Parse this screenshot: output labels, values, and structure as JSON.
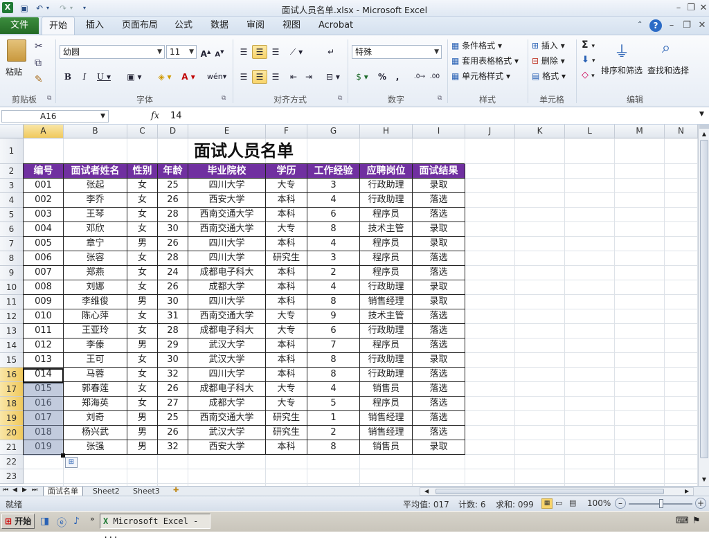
{
  "window": {
    "title": "面试人员名单.xlsx - Microsoft Excel"
  },
  "tabs": {
    "file": "文件",
    "home": "开始",
    "insert": "插入",
    "layout": "页面布局",
    "formulas": "公式",
    "data": "数据",
    "review": "审阅",
    "view": "视图",
    "acrobat": "Acrobat"
  },
  "ribbon": {
    "clipboard": {
      "label": "剪贴板",
      "paste": "粘贴"
    },
    "font": {
      "label": "字体",
      "name": "幼圆",
      "size": "11"
    },
    "align": {
      "label": "对齐方式"
    },
    "number": {
      "label": "数字",
      "format": "特殊",
      "percent": "%",
      "comma": ","
    },
    "styles": {
      "label": "样式",
      "cond": "条件格式",
      "table": "套用表格格式",
      "cellstyle": "单元格样式"
    },
    "cells": {
      "label": "单元格",
      "insert": "插入",
      "delete": "删除",
      "format": "格式"
    },
    "edit": {
      "label": "编辑",
      "sum": "Σ",
      "sort": "排序和筛选",
      "find": "查找和选择"
    }
  },
  "formula_bar": {
    "name_box": "A16",
    "fx": "fx",
    "value": "14"
  },
  "columns": [
    "A",
    "B",
    "C",
    "D",
    "E",
    "F",
    "G",
    "H",
    "I",
    "J",
    "K",
    "L",
    "M",
    "N"
  ],
  "rows": [
    "1",
    "2",
    "3",
    "4",
    "5",
    "6",
    "7",
    "8",
    "9",
    "10",
    "11",
    "12",
    "13",
    "14",
    "15",
    "16",
    "17",
    "18",
    "19",
    "20",
    "21",
    "22",
    "23"
  ],
  "sheet_title": "面试人员名单",
  "table": {
    "headers": [
      "编号",
      "面试者姓名",
      "性别",
      "年龄",
      "毕业院校",
      "学历",
      "工作经验",
      "应聘岗位",
      "面试结果"
    ],
    "rows": [
      [
        "001",
        "张起",
        "女",
        "25",
        "四川大学",
        "大专",
        "3",
        "行政助理",
        "录取"
      ],
      [
        "002",
        "李乔",
        "女",
        "26",
        "西安大学",
        "本科",
        "4",
        "行政助理",
        "落选"
      ],
      [
        "003",
        "王琴",
        "女",
        "28",
        "西南交通大学",
        "本科",
        "6",
        "程序员",
        "落选"
      ],
      [
        "004",
        "邓欣",
        "女",
        "30",
        "西南交通大学",
        "大专",
        "8",
        "技术主管",
        "录取"
      ],
      [
        "005",
        "章宁",
        "男",
        "26",
        "四川大学",
        "本科",
        "4",
        "程序员",
        "录取"
      ],
      [
        "006",
        "张容",
        "女",
        "28",
        "四川大学",
        "研究生",
        "3",
        "程序员",
        "落选"
      ],
      [
        "007",
        "郑燕",
        "女",
        "24",
        "成都电子科大",
        "本科",
        "2",
        "程序员",
        "落选"
      ],
      [
        "008",
        "刘娜",
        "女",
        "26",
        "成都大学",
        "本科",
        "4",
        "行政助理",
        "录取"
      ],
      [
        "009",
        "李维俊",
        "男",
        "30",
        "四川大学",
        "本科",
        "8",
        "销售经理",
        "录取"
      ],
      [
        "010",
        "陈心萍",
        "女",
        "31",
        "西南交通大学",
        "大专",
        "9",
        "技术主管",
        "落选"
      ],
      [
        "011",
        "王亚玲",
        "女",
        "28",
        "成都电子科大",
        "大专",
        "6",
        "行政助理",
        "落选"
      ],
      [
        "012",
        "李傣",
        "男",
        "29",
        "武汉大学",
        "本科",
        "7",
        "程序员",
        "落选"
      ],
      [
        "013",
        "王可",
        "女",
        "30",
        "武汉大学",
        "本科",
        "8",
        "行政助理",
        "录取"
      ],
      [
        "014",
        "马蓉",
        "女",
        "32",
        "四川大学",
        "本科",
        "8",
        "行政助理",
        "落选"
      ],
      [
        "015",
        "郭春莲",
        "女",
        "26",
        "成都电子科大",
        "大专",
        "4",
        "销售员",
        "落选"
      ],
      [
        "016",
        "郑海英",
        "女",
        "27",
        "成都大学",
        "大专",
        "5",
        "程序员",
        "落选"
      ],
      [
        "017",
        "刘奇",
        "男",
        "25",
        "西南交通大学",
        "研究生",
        "1",
        "销售经理",
        "落选"
      ],
      [
        "018",
        "杨兴武",
        "男",
        "26",
        "武汉大学",
        "研究生",
        "2",
        "销售经理",
        "落选"
      ],
      [
        "019",
        "张强",
        "男",
        "32",
        "西安大学",
        "本科",
        "8",
        "销售员",
        "录取"
      ]
    ]
  },
  "sheets": [
    "面试名单",
    "Sheet2",
    "Sheet3"
  ],
  "status": {
    "ready": "就绪",
    "average": "平均值: 017",
    "count": "计数: 6",
    "sum": "求和: 099",
    "zoom": "100%"
  },
  "taskbar": {
    "start": "开始",
    "app": "Microsoft Excel - ..."
  }
}
